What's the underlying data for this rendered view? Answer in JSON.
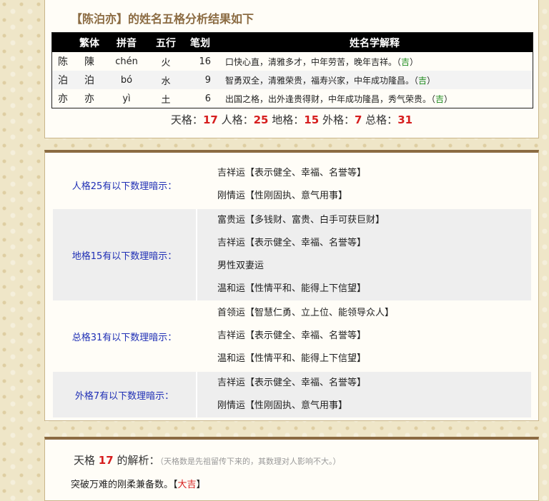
{
  "header": {
    "title": "【陈泊亦】的姓名五格分析结果如下"
  },
  "table": {
    "columns": [
      "繁体",
      "拼音",
      "五行",
      "笔划",
      "姓名学解释"
    ],
    "rows": [
      {
        "simplified": "陈",
        "traditional": "陳",
        "pinyin": "chén",
        "wuxing": "火",
        "strokes": "16",
        "meaning": "口快心直，清雅多才，中年劳苦，晚年吉祥。",
        "luck": "吉"
      },
      {
        "simplified": "泊",
        "traditional": "泊",
        "pinyin": "bó",
        "wuxing": "水",
        "strokes": "9",
        "meaning": "智勇双全，清雅荣贵，福寿兴家，中年成功隆昌。",
        "luck": "吉"
      },
      {
        "simplified": "亦",
        "traditional": "亦",
        "pinyin": "yì",
        "wuxing": "土",
        "strokes": "6",
        "meaning": "出国之格，出外逢贵得财，中年成功隆昌，秀气荣贵。",
        "luck": "吉"
      }
    ]
  },
  "summary": {
    "tiange_label": "天格：",
    "tiange": "17",
    "renge_label": "人格：",
    "renge": "25",
    "dige_label": "地格：",
    "dige": "15",
    "waige_label": "外格：",
    "waige": "7",
    "zongge_label": "总格：",
    "zongge": "31"
  },
  "hints": [
    {
      "label": "人格25有以下数理暗示：",
      "items": [
        "吉祥运【表示健全、幸福、名誉等】",
        "刚情运【性刚固执、意气用事】"
      ]
    },
    {
      "label": "地格15有以下数理暗示：",
      "items": [
        "富贵运【多钱财、富贵、白手可获巨财】",
        "吉祥运【表示健全、幸福、名誉等】",
        "男性双妻运",
        "温和运【性情平和、能得上下信望】"
      ]
    },
    {
      "label": "总格31有以下数理暗示：",
      "items": [
        "首领运【智慧仁勇、立上位、能领导众人】",
        "吉祥运【表示健全、幸福、名誉等】",
        "温和运【性情平和、能得上下信望】"
      ]
    },
    {
      "label": "外格7有以下数理暗示：",
      "items": [
        "吉祥运【表示健全、幸福、名誉等】",
        "刚情运【性刚固执、意气用事】"
      ]
    }
  ],
  "analysis": {
    "prefix": "天格",
    "number": "17",
    "suffix": "的解析：",
    "note": "（天格数是先祖留传下来的，其数理对人影响不大。）",
    "text": "突破万难的刚柔兼备数。",
    "verdict": "大吉"
  }
}
